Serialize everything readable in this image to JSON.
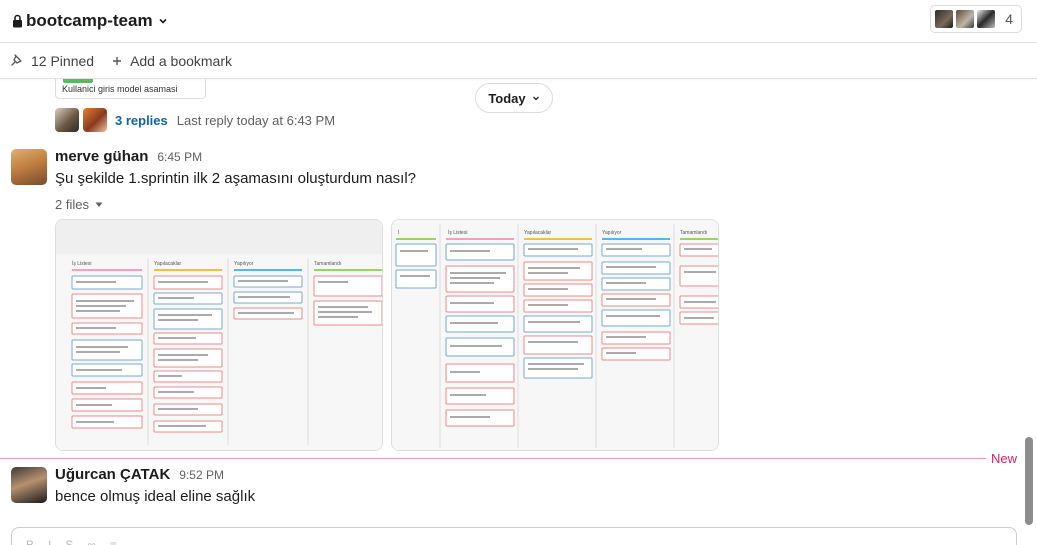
{
  "header": {
    "channel_name": "bootcamp-team",
    "member_count": "4"
  },
  "pinbar": {
    "pinned_label": "12 Pinned",
    "bookmark_label": "Add a bookmark"
  },
  "previous_thread": {
    "card_caption": "Kullanici giris model asamasi",
    "replies_label": "3 replies",
    "last_reply": "Last reply today at 6:43 PM"
  },
  "date_divider": {
    "label": "Today"
  },
  "messages": [
    {
      "author": "merve gühan",
      "time": "6:45 PM",
      "text": "Şu şekilde 1.sprintin ilk 2 aşamasını oluşturdum nasıl?",
      "files_label": "2 files"
    },
    {
      "author": "Uğurcan ÇATAK",
      "time": "9:52 PM",
      "text": "bence olmuş ideal eline sağlık"
    }
  ],
  "new_divider": {
    "label": "New"
  },
  "colors": {
    "link": "#1264a3",
    "new_marker": "#e01e5a"
  },
  "icons": [
    "lock-icon",
    "chevron-down-icon",
    "pin-icon",
    "plus-icon",
    "caret-down-icon"
  ]
}
